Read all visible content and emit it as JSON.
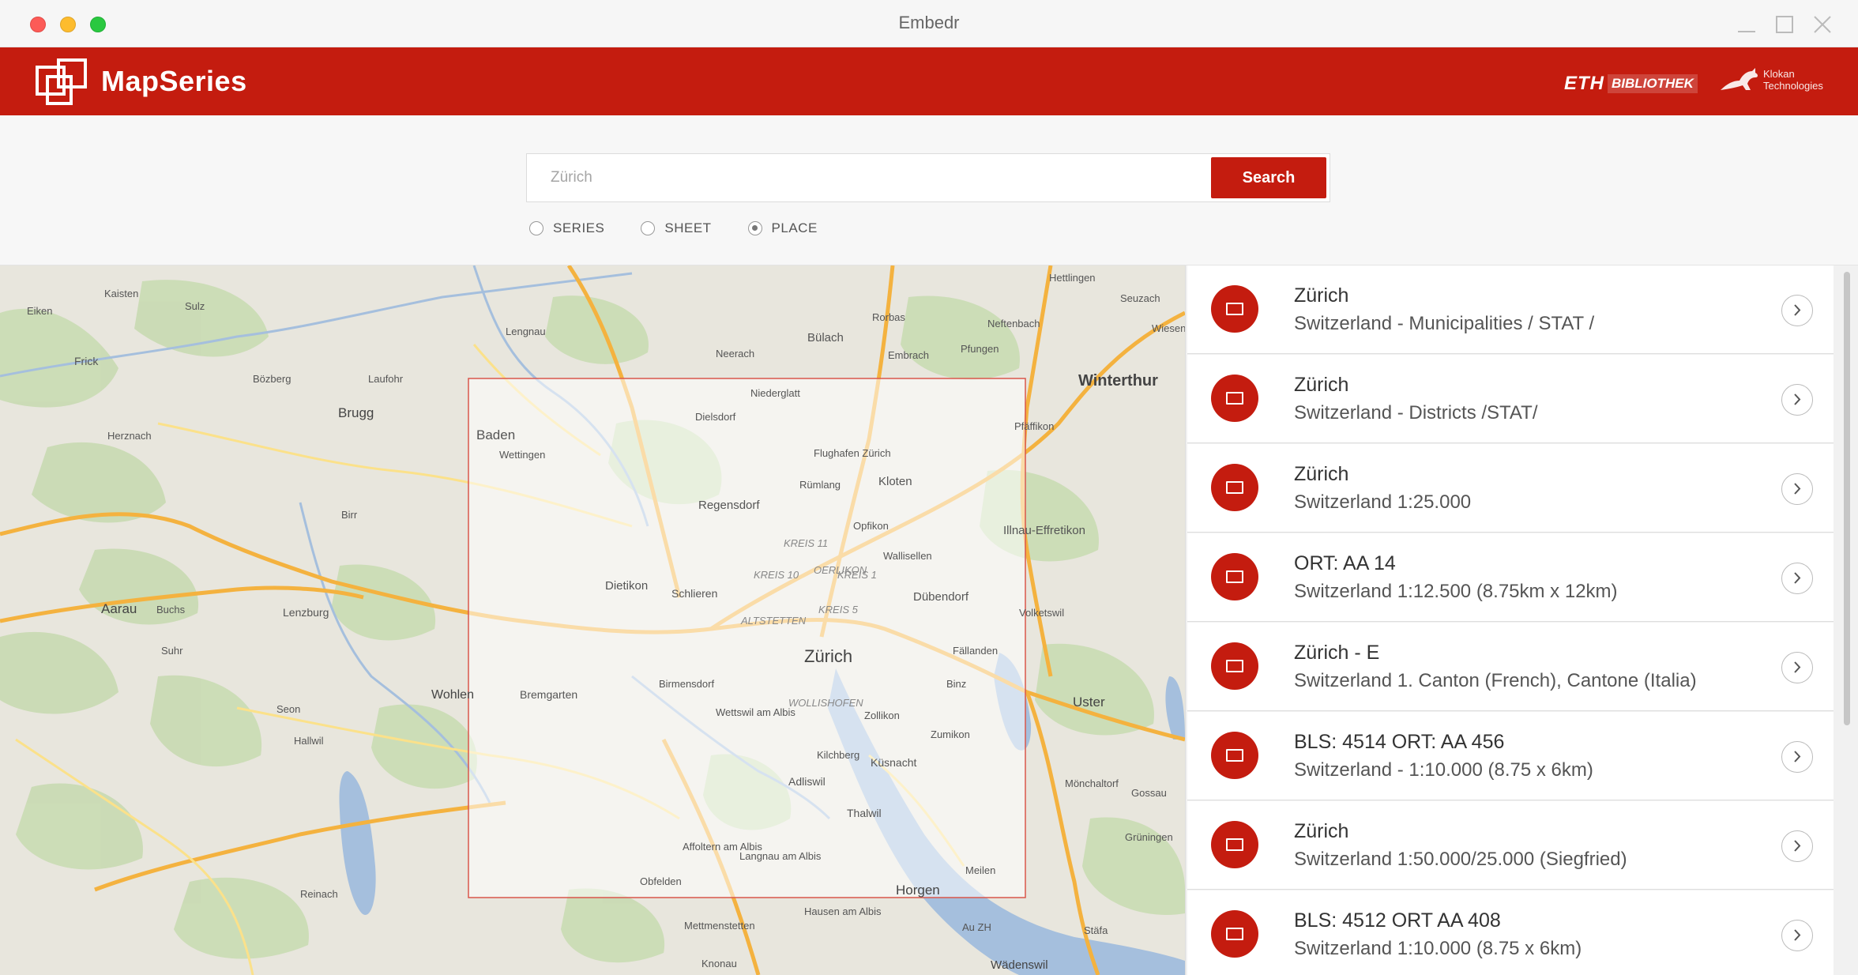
{
  "window": {
    "title": "Embedr"
  },
  "header": {
    "app_name": "MapSeries",
    "partner_eth": "ETH",
    "partner_bibliothek": "BIBLIOTHEK",
    "partner_klokan": "Klokan Technologies"
  },
  "search": {
    "placeholder": "Zürich",
    "button_label": "Search",
    "options": [
      {
        "label": "SERIES",
        "selected": false
      },
      {
        "label": "SHEET",
        "selected": false
      },
      {
        "label": "PLACE",
        "selected": true
      }
    ]
  },
  "map": {
    "labels": {
      "zurich": "Zürich",
      "winterthur": "Winterthur",
      "baden": "Baden",
      "brugg": "Brugg",
      "aarau": "Aarau",
      "uster": "Uster",
      "kloten": "Kloten",
      "dietikon": "Dietikon",
      "regensdorf": "Regensdorf",
      "bulach": "Bülach",
      "horgen": "Horgen",
      "thalwil": "Thalwil",
      "kusnacht": "Küsnacht",
      "adliswil": "Adliswil",
      "wohlen": "Wohlen",
      "lenzburg": "Lenzburg",
      "dubendorf": "Dübendorf",
      "wallisellen": "Wallisellen",
      "opfikon": "Opfikon",
      "schlieren": "Schlieren",
      "bremgarten": "Bremgarten",
      "embrach": "Embrach",
      "neerach": "Neerach",
      "lengnau": "Lengnau",
      "wettingen": "Wettingen",
      "frick": "Frick",
      "kaisten": "Kaisten",
      "eiken": "Eiken",
      "sulz": "Sulz",
      "bozberg": "Bözberg",
      "laufohr": "Laufohr",
      "herznach": "Herznach",
      "birr": "Birr",
      "buchs": "Buchs",
      "suhr": "Suhr",
      "seon": "Seon",
      "hallwil": "Hallwil",
      "reinach": "Reinach",
      "effretikon": "Illnau-Effretikon",
      "volketswil": "Volketswil",
      "fallanden": "Fällanden",
      "zumikon": "Zumikon",
      "meilen": "Meilen",
      "stafa": "Stäfa",
      "wadenswil": "Wädenswil",
      "gossau": "Gossau",
      "gruningen": "Grüningen",
      "monchaltorf": "Mönchaltorf",
      "pfaffikon": "Pfäffikon",
      "hettlingen": "Hettlingen",
      "seuzach": "Seuzach",
      "neftenbach": "Neftenbach",
      "pfungen": "Pfungen",
      "rorbas": "Rorbas",
      "kreis1": "KREIS 1",
      "kreis5": "KREIS 5",
      "kreis11": "KREIS 11",
      "kreis10": "KREIS 10",
      "oerlikon": "OERLIKON",
      "altstetten": "ALTSTETTEN",
      "wollishofen": "WOLLISHOFEN",
      "affoltern": "Affoltern am Albis",
      "birmensdorf": "Birmensdorf",
      "wettswil": "Wettswil am Albis",
      "langnau": "Langnau am Albis",
      "zollikon": "Zollikon",
      "binz": "Binz",
      "kilchberg": "Kilchberg",
      "rumlang": "Rümlang",
      "dielsdorf": "Dielsdorf",
      "niederglatt": "Niederglatt",
      "flughafen": "Flughafen Zürich",
      "hausen": "Hausen am Albis",
      "obfelden": "Obfelden",
      "mettmenstetten": "Mettmenstetten",
      "knonau": "Knonau",
      "au": "Au ZH",
      "wiesen": "Wiesen"
    }
  },
  "results": [
    {
      "title": "Zürich",
      "subtitle": "Switzerland - Municipalities / STAT /"
    },
    {
      "title": "Zürich",
      "subtitle": "Switzerland - Districts /STAT/"
    },
    {
      "title": "Zürich",
      "subtitle": "Switzerland 1:25.000"
    },
    {
      "title": "ORT: AA 14",
      "subtitle": "Switzerland 1:12.500 (8.75km x 12km)"
    },
    {
      "title": "Zürich - E",
      "subtitle": "Switzerland 1. Canton (French), Cantone (Italia)"
    },
    {
      "title": "BLS: 4514 ORT: AA 456",
      "subtitle": "Switzerland - 1:10.000 (8.75 x 6km)"
    },
    {
      "title": "Zürich",
      "subtitle": "Switzerland 1:50.000/25.000 (Siegfried)"
    },
    {
      "title": "BLS: 4512 ORT AA 408",
      "subtitle": "Switzerland 1:10.000 (8.75 x 6km)"
    }
  ],
  "colors": {
    "brand_red": "#c41c0f",
    "map_land": "#e8e6dd",
    "map_water": "#a5bfdd",
    "map_forest": "#c7dab0",
    "highway": "#f4b23f"
  }
}
